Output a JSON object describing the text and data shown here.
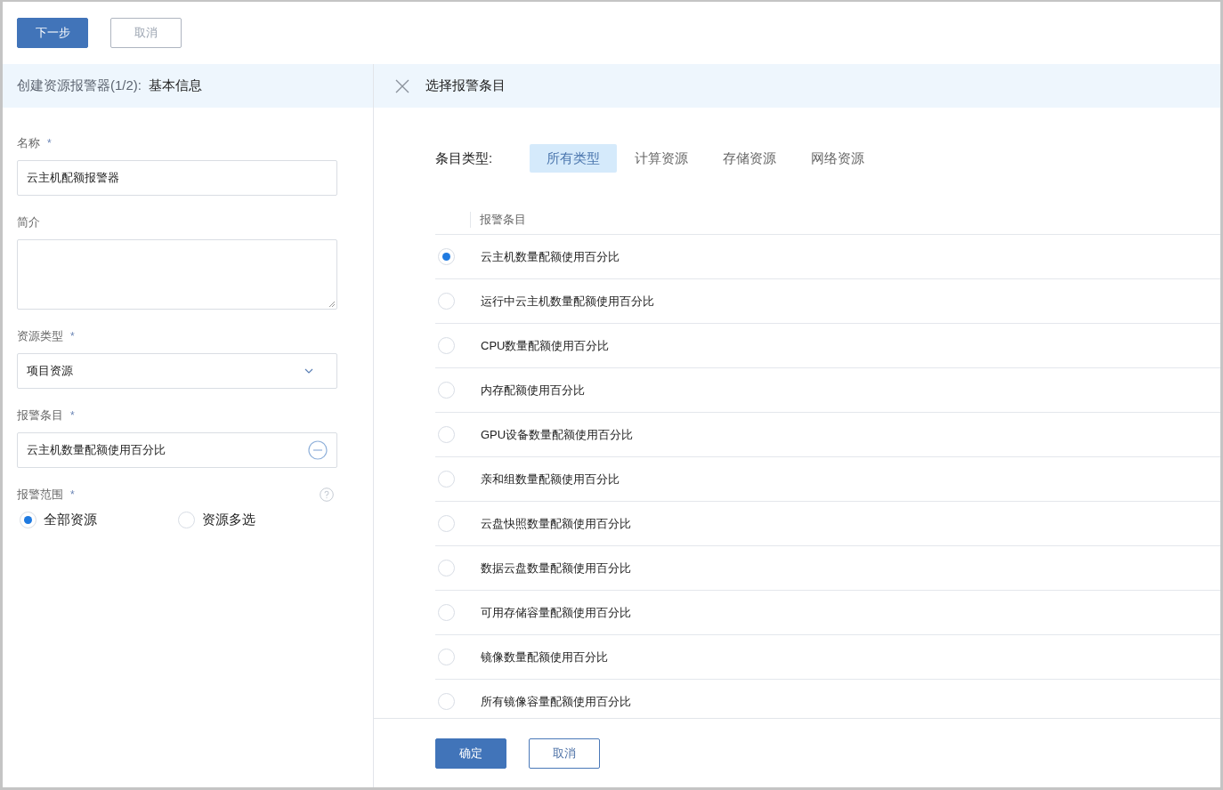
{
  "toolbar": {
    "buttons": [
      {
        "label": "下一步",
        "kind": "primary"
      },
      {
        "label": "取消",
        "kind": "muted"
      }
    ]
  },
  "left_panel": {
    "title": "创建资源报警器(1/2):",
    "subtitle": "基本信息",
    "fields": [
      {
        "label": "名称",
        "required_mark": "*",
        "kind": "text",
        "value": "云主机配额报警器"
      },
      {
        "label": "简介",
        "kind": "textarea"
      },
      {
        "label": "资源类型",
        "required_mark": "*",
        "kind": "select",
        "value": "项目资源"
      },
      {
        "label": "报警条目",
        "required_mark": "*",
        "kind": "removable",
        "value": "云主机数量配额使用百分比"
      },
      {
        "label": "报警范围",
        "required_mark": "*",
        "kind": "radio",
        "help": true,
        "options": [
          {
            "label": "全部资源",
            "selected": true
          },
          {
            "label": "资源多选",
            "selected": false
          }
        ]
      }
    ]
  },
  "right_panel": {
    "title": "选择报警条目",
    "filter_label": "条目类型:",
    "tabs": [
      {
        "label": "所有类型",
        "selected": true
      },
      {
        "label": "计算资源",
        "selected": false
      },
      {
        "label": "存储资源",
        "selected": false
      },
      {
        "label": "网络资源",
        "selected": false
      }
    ],
    "table": {
      "columns": [
        "报警条目"
      ],
      "rows": [
        {
          "name": "云主机数量配额使用百分比",
          "selected": true
        },
        {
          "name": "运行中云主机数量配额使用百分比",
          "selected": false
        },
        {
          "name": "CPU数量配额使用百分比",
          "selected": false
        },
        {
          "name": "内存配额使用百分比",
          "selected": false
        },
        {
          "name": "GPU设备数量配额使用百分比",
          "selected": false
        },
        {
          "name": "亲和组数量配额使用百分比",
          "selected": false
        },
        {
          "name": "云盘快照数量配额使用百分比",
          "selected": false
        },
        {
          "name": "数据云盘数量配额使用百分比",
          "selected": false
        },
        {
          "name": "可用存储容量配额使用百分比",
          "selected": false
        },
        {
          "name": "镜像数量配额使用百分比",
          "selected": false
        },
        {
          "name": "所有镜像容量配额使用百分比",
          "selected": false
        }
      ]
    },
    "buttons": [
      {
        "label": "确定",
        "kind": "primary"
      },
      {
        "label": "取消",
        "kind": "default"
      }
    ]
  }
}
